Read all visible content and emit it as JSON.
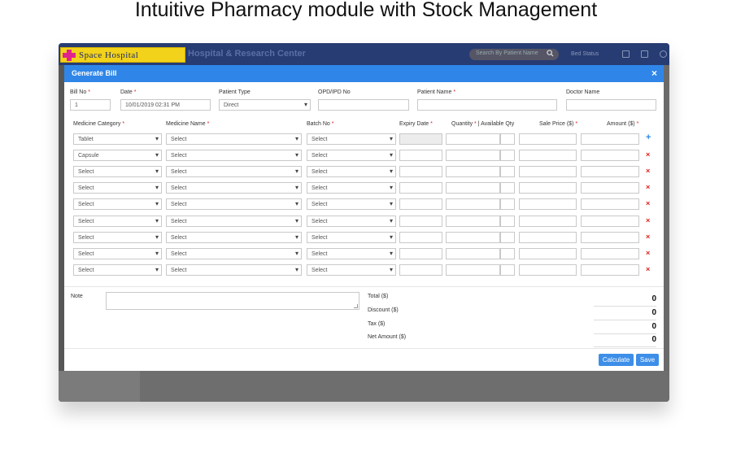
{
  "page_title": "Intuitive Pharmacy module with Stock Management",
  "app": {
    "logo_text": "Space Hospital",
    "org_name": "Hospital & Research Center",
    "search_placeholder": "Search By Patient Name",
    "bed_status": "Bed Status"
  },
  "modal": {
    "title": "Generate Bill",
    "close": "×",
    "bill_no": {
      "label": "Bill No",
      "value": "1"
    },
    "date": {
      "label": "Date",
      "value": "10/01/2019 02:31 PM"
    },
    "patient_type": {
      "label": "Patient Type",
      "value": "Direct"
    },
    "opd_ipd": {
      "label": "OPD/IPD No",
      "value": ""
    },
    "patient_name": {
      "label": "Patient Name",
      "value": ""
    },
    "doctor_name": {
      "label": "Doctor Name",
      "value": ""
    },
    "columns": {
      "category": "Medicine Category",
      "name": "Medicine Name",
      "batch": "Batch No",
      "expiry": "Expiry Date",
      "quantity": "Quantity",
      "available": "| Available Qty",
      "sale_price": "Sale Price ($)",
      "amount": "Amount ($)"
    },
    "rows": [
      {
        "category": "Tablet",
        "name": "Select",
        "batch": "Select"
      },
      {
        "category": "Capsule",
        "name": "Select",
        "batch": "Select"
      },
      {
        "category": "Select",
        "name": "Select",
        "batch": "Select"
      },
      {
        "category": "Select",
        "name": "Select",
        "batch": "Select"
      },
      {
        "category": "Select",
        "name": "Select",
        "batch": "Select"
      },
      {
        "category": "Select",
        "name": "Select",
        "batch": "Select"
      },
      {
        "category": "Select",
        "name": "Select",
        "batch": "Select"
      },
      {
        "category": "Select",
        "name": "Select",
        "batch": "Select"
      },
      {
        "category": "Select",
        "name": "Select",
        "batch": "Select"
      }
    ],
    "add_icon": "+",
    "delete_icon": "×",
    "note_label": "Note",
    "totals": [
      {
        "label": "Total ($)",
        "value": "0"
      },
      {
        "label": "Discount ($)",
        "value": "0"
      },
      {
        "label": "Tax ($)",
        "value": "0"
      },
      {
        "label": "Net Amount ($)",
        "value": "0"
      }
    ],
    "calculate_label": "Calculate",
    "save_label": "Save"
  },
  "colors": {
    "header": "#2f86e8",
    "topbar": "#273c72",
    "required": "#e02020",
    "logo_bg": "#f2d21a",
    "logo_cross": "#e0248c"
  }
}
